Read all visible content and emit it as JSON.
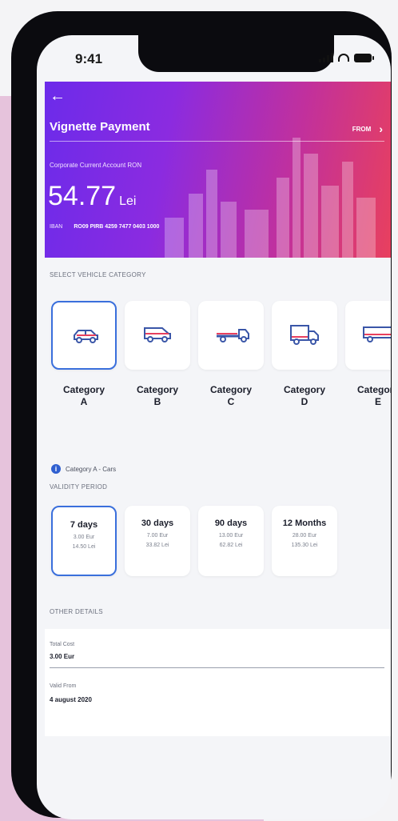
{
  "status": {
    "time": "9:41"
  },
  "header": {
    "title": "Vignette Payment",
    "from_label": "FROM",
    "account_name": "Corporate Current Account RON",
    "amount": "54.77",
    "currency": "Lei",
    "iban_label": "IBAN",
    "iban_value": "RO09 PIRB 4259 7477 0403 1000",
    "colors": {
      "gradient_start": "#6c2bea",
      "gradient_end": "#e8405e"
    }
  },
  "vehicle_section": {
    "label": "SELECT VEHICLE CATEGORY",
    "categories": [
      {
        "name": "Category",
        "letter": "A",
        "icon": "car-icon",
        "selected": true
      },
      {
        "name": "Category",
        "letter": "B",
        "icon": "van-icon",
        "selected": false
      },
      {
        "name": "Category",
        "letter": "C",
        "icon": "flatbed-truck-icon",
        "selected": false
      },
      {
        "name": "Category",
        "letter": "D",
        "icon": "box-truck-icon",
        "selected": false
      },
      {
        "name": "Category",
        "letter": "E",
        "icon": "trailer-truck-icon",
        "selected": false
      }
    ],
    "info_text": "Category A - Cars"
  },
  "validity_section": {
    "label": "VALIDITY PERIOD",
    "periods": [
      {
        "title": "7 days",
        "eur": "3.00 Eur",
        "lei": "14.50 Lei",
        "selected": true
      },
      {
        "title": "30 days",
        "eur": "7.00 Eur",
        "lei": "33.82 Lei",
        "selected": false
      },
      {
        "title": "90 days",
        "eur": "13.00 Eur",
        "lei": "62.82 Lei",
        "selected": false
      },
      {
        "title": "12 Months",
        "eur": "28.00 Eur",
        "lei": "135.30 Lei",
        "selected": false
      }
    ]
  },
  "other_details": {
    "label": "OTHER DETAILS",
    "total_cost_label": "Total Cost",
    "total_cost_value": "3.00 Eur",
    "valid_from_label": "Valid From",
    "valid_from_value": "4 august 2020"
  },
  "accent_color": "#3a6fdc"
}
